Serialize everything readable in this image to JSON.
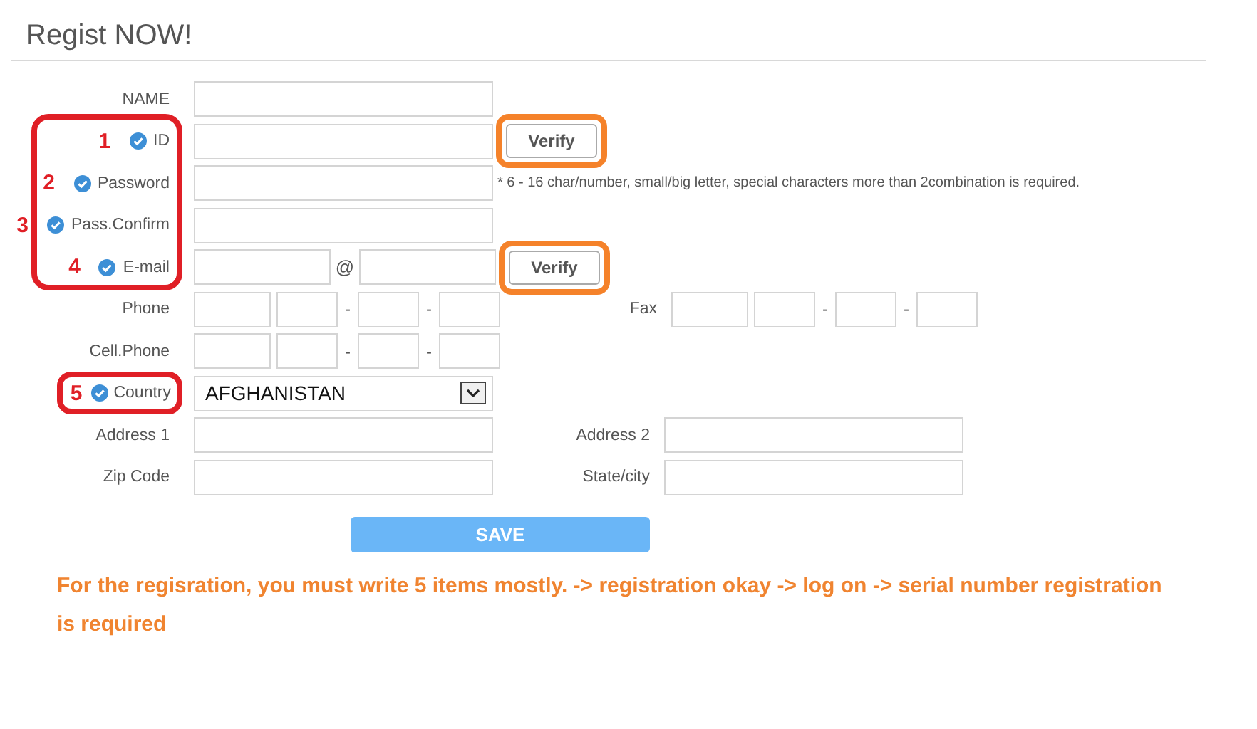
{
  "title": "Regist NOW!",
  "rows": [
    {
      "kind": "single",
      "label": "NAME",
      "required": false
    },
    {
      "kind": "single",
      "label": "ID",
      "required": true,
      "marker": "1",
      "button": {
        "label": "Verify",
        "highlighted": true
      }
    },
    {
      "kind": "single",
      "label": "Password",
      "required": true,
      "marker": "2",
      "note": "* 6 - 16 char/number, small/big letter, special characters more than 2combination is required."
    },
    {
      "kind": "single",
      "label": "Pass.Confirm",
      "required": true,
      "marker": "3"
    },
    {
      "kind": "email",
      "label": "E-mail",
      "required": true,
      "marker": "4",
      "separator": "@",
      "button": {
        "label": "Verify",
        "highlighted": true
      }
    },
    {
      "kind": "phone",
      "label": "Phone",
      "required": false,
      "separators": [
        "-",
        "-"
      ],
      "second": {
        "kind": "phone",
        "label": "Fax",
        "separators": [
          "-",
          "-"
        ]
      }
    },
    {
      "kind": "phone",
      "label": "Cell.Phone",
      "required": false,
      "separators": [
        "-",
        "-"
      ]
    },
    {
      "kind": "select",
      "label": "Country",
      "required": true,
      "marker": "5",
      "value": "AFGHANISTAN"
    },
    {
      "kind": "single",
      "label": "Address 1",
      "required": false,
      "second": {
        "kind": "single",
        "label": "Address 2"
      }
    },
    {
      "kind": "single",
      "label": "Zip Code",
      "required": false,
      "second": {
        "kind": "single",
        "label": "State/city"
      }
    }
  ],
  "submit": "SAVE",
  "notice": "For the regisration, you must write 5 items mostly.  -> registration okay -> log on -> serial number registration is required"
}
